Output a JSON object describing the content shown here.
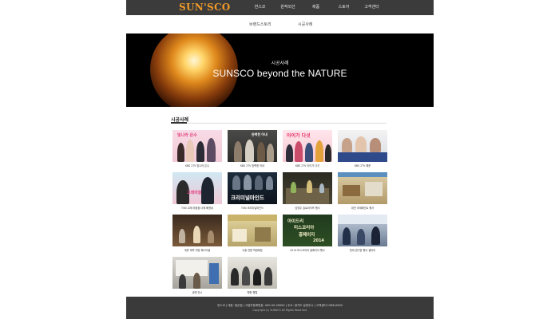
{
  "header": {
    "logo": "SUN'SCO",
    "nav": [
      "썬스코",
      "원적외선",
      "제품",
      "스토어",
      "고객센터"
    ]
  },
  "subnav": [
    "브랜드스토리",
    "시공사례"
  ],
  "hero": {
    "subtitle": "시공사례",
    "title": "SUNSCO beyond the NATURE"
  },
  "section": {
    "title": "시공사례"
  },
  "items": [
    {
      "caption": "KBS 2TV 빛나라 은수"
    },
    {
      "caption": "KBS 2TV 완벽한 아내"
    },
    {
      "caption": "KBS 2TV 아이가 다섯"
    },
    {
      "caption": "KBS 2TV 해운"
    },
    {
      "caption": "TVN 고래 마을을 너에 빠졌네"
    },
    {
      "caption": "TVN 크리미널마인드"
    },
    {
      "caption": "남양주 슬로라이프 행사"
    },
    {
      "caption": "대전 국제페인트 행사"
    },
    {
      "caption": "세를 마루 리빙 페스티벌"
    },
    {
      "caption": "수출 전용 박람회장"
    },
    {
      "caption": "2014 미스코리아 홍페이지 행사"
    },
    {
      "caption": "현대 경기장 행사 갤러리"
    },
    {
      "caption": "공예 전시"
    },
    {
      "caption": "행운 행렬"
    }
  ],
  "footer": {
    "line1": "썬스코 | 대표: 정순범 | 사업자등록번호: 000-00-00000 | 주소: 경기도 남양주시 | 고객센터 1566-0000",
    "line2": "Copyright (c) SUNSCO All Rights Reserved."
  }
}
